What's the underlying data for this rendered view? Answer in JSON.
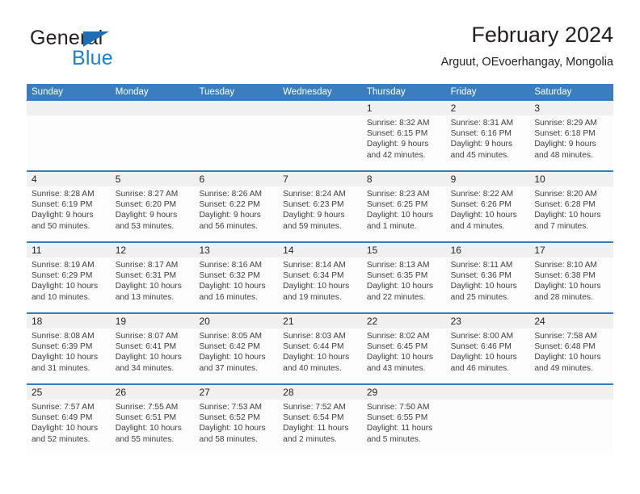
{
  "brand": {
    "word_one": "General",
    "word_two": "Blue",
    "triangle_icon": "blue-triangle-logo-mark",
    "colors": {
      "dark": "#231f20",
      "blue": "#1b7fd4",
      "triangle": "#1f6db5"
    }
  },
  "header": {
    "title": "February 2024",
    "subtitle": "Arguut, OEvoerhangay, Mongolia"
  },
  "calendar": {
    "accent_color": "#3a7ebf",
    "date_band_color": "#f0f0f0",
    "weekdays": [
      "Sunday",
      "Monday",
      "Tuesday",
      "Wednesday",
      "Thursday",
      "Friday",
      "Saturday"
    ],
    "weeks": [
      [
        {
          "date": "",
          "lines": []
        },
        {
          "date": "",
          "lines": []
        },
        {
          "date": "",
          "lines": []
        },
        {
          "date": "",
          "lines": []
        },
        {
          "date": "1",
          "lines": [
            "Sunrise: 8:32 AM",
            "Sunset: 6:15 PM",
            "Daylight: 9 hours",
            "and 42 minutes."
          ]
        },
        {
          "date": "2",
          "lines": [
            "Sunrise: 8:31 AM",
            "Sunset: 6:16 PM",
            "Daylight: 9 hours",
            "and 45 minutes."
          ]
        },
        {
          "date": "3",
          "lines": [
            "Sunrise: 8:29 AM",
            "Sunset: 6:18 PM",
            "Daylight: 9 hours",
            "and 48 minutes."
          ]
        }
      ],
      [
        {
          "date": "4",
          "lines": [
            "Sunrise: 8:28 AM",
            "Sunset: 6:19 PM",
            "Daylight: 9 hours",
            "and 50 minutes."
          ]
        },
        {
          "date": "5",
          "lines": [
            "Sunrise: 8:27 AM",
            "Sunset: 6:20 PM",
            "Daylight: 9 hours",
            "and 53 minutes."
          ]
        },
        {
          "date": "6",
          "lines": [
            "Sunrise: 8:26 AM",
            "Sunset: 6:22 PM",
            "Daylight: 9 hours",
            "and 56 minutes."
          ]
        },
        {
          "date": "7",
          "lines": [
            "Sunrise: 8:24 AM",
            "Sunset: 6:23 PM",
            "Daylight: 9 hours",
            "and 59 minutes."
          ]
        },
        {
          "date": "8",
          "lines": [
            "Sunrise: 8:23 AM",
            "Sunset: 6:25 PM",
            "Daylight: 10 hours",
            "and 1 minute."
          ]
        },
        {
          "date": "9",
          "lines": [
            "Sunrise: 8:22 AM",
            "Sunset: 6:26 PM",
            "Daylight: 10 hours",
            "and 4 minutes."
          ]
        },
        {
          "date": "10",
          "lines": [
            "Sunrise: 8:20 AM",
            "Sunset: 6:28 PM",
            "Daylight: 10 hours",
            "and 7 minutes."
          ]
        }
      ],
      [
        {
          "date": "11",
          "lines": [
            "Sunrise: 8:19 AM",
            "Sunset: 6:29 PM",
            "Daylight: 10 hours",
            "and 10 minutes."
          ]
        },
        {
          "date": "12",
          "lines": [
            "Sunrise: 8:17 AM",
            "Sunset: 6:31 PM",
            "Daylight: 10 hours",
            "and 13 minutes."
          ]
        },
        {
          "date": "13",
          "lines": [
            "Sunrise: 8:16 AM",
            "Sunset: 6:32 PM",
            "Daylight: 10 hours",
            "and 16 minutes."
          ]
        },
        {
          "date": "14",
          "lines": [
            "Sunrise: 8:14 AM",
            "Sunset: 6:34 PM",
            "Daylight: 10 hours",
            "and 19 minutes."
          ]
        },
        {
          "date": "15",
          "lines": [
            "Sunrise: 8:13 AM",
            "Sunset: 6:35 PM",
            "Daylight: 10 hours",
            "and 22 minutes."
          ]
        },
        {
          "date": "16",
          "lines": [
            "Sunrise: 8:11 AM",
            "Sunset: 6:36 PM",
            "Daylight: 10 hours",
            "and 25 minutes."
          ]
        },
        {
          "date": "17",
          "lines": [
            "Sunrise: 8:10 AM",
            "Sunset: 6:38 PM",
            "Daylight: 10 hours",
            "and 28 minutes."
          ]
        }
      ],
      [
        {
          "date": "18",
          "lines": [
            "Sunrise: 8:08 AM",
            "Sunset: 6:39 PM",
            "Daylight: 10 hours",
            "and 31 minutes."
          ]
        },
        {
          "date": "19",
          "lines": [
            "Sunrise: 8:07 AM",
            "Sunset: 6:41 PM",
            "Daylight: 10 hours",
            "and 34 minutes."
          ]
        },
        {
          "date": "20",
          "lines": [
            "Sunrise: 8:05 AM",
            "Sunset: 6:42 PM",
            "Daylight: 10 hours",
            "and 37 minutes."
          ]
        },
        {
          "date": "21",
          "lines": [
            "Sunrise: 8:03 AM",
            "Sunset: 6:44 PM",
            "Daylight: 10 hours",
            "and 40 minutes."
          ]
        },
        {
          "date": "22",
          "lines": [
            "Sunrise: 8:02 AM",
            "Sunset: 6:45 PM",
            "Daylight: 10 hours",
            "and 43 minutes."
          ]
        },
        {
          "date": "23",
          "lines": [
            "Sunrise: 8:00 AM",
            "Sunset: 6:46 PM",
            "Daylight: 10 hours",
            "and 46 minutes."
          ]
        },
        {
          "date": "24",
          "lines": [
            "Sunrise: 7:58 AM",
            "Sunset: 6:48 PM",
            "Daylight: 10 hours",
            "and 49 minutes."
          ]
        }
      ],
      [
        {
          "date": "25",
          "lines": [
            "Sunrise: 7:57 AM",
            "Sunset: 6:49 PM",
            "Daylight: 10 hours",
            "and 52 minutes."
          ]
        },
        {
          "date": "26",
          "lines": [
            "Sunrise: 7:55 AM",
            "Sunset: 6:51 PM",
            "Daylight: 10 hours",
            "and 55 minutes."
          ]
        },
        {
          "date": "27",
          "lines": [
            "Sunrise: 7:53 AM",
            "Sunset: 6:52 PM",
            "Daylight: 10 hours",
            "and 58 minutes."
          ]
        },
        {
          "date": "28",
          "lines": [
            "Sunrise: 7:52 AM",
            "Sunset: 6:54 PM",
            "Daylight: 11 hours",
            "and 2 minutes."
          ]
        },
        {
          "date": "29",
          "lines": [
            "Sunrise: 7:50 AM",
            "Sunset: 6:55 PM",
            "Daylight: 11 hours",
            "and 5 minutes."
          ]
        },
        {
          "date": "",
          "lines": []
        },
        {
          "date": "",
          "lines": []
        }
      ]
    ]
  }
}
